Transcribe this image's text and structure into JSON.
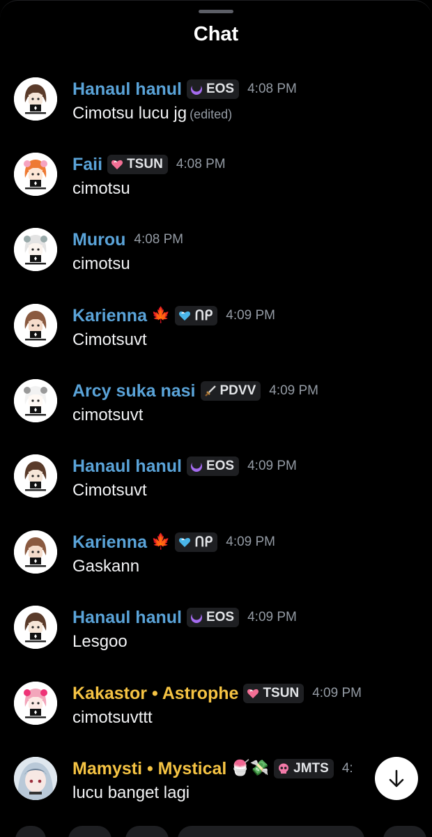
{
  "header": {
    "title": "Chat"
  },
  "messages": [
    {
      "avatar": "hanaul-avatar",
      "name": "Hanaul hanul",
      "name_color": "#5aa3d8",
      "emoji": "",
      "tag": {
        "icon": "moon-icon",
        "label": "EOS"
      },
      "time": "4:08 PM",
      "text": "Cimotsu lucu jg",
      "edited": "(edited)"
    },
    {
      "avatar": "faii-avatar",
      "name": "Faii",
      "name_color": "#5aa3d8",
      "emoji": "",
      "tag": {
        "icon": "pink-heart-icon",
        "label": "TSUN"
      },
      "time": "4:08 PM",
      "text": "cimotsu",
      "edited": ""
    },
    {
      "avatar": "murou-avatar",
      "name": "Murou",
      "name_color": "#5aa3d8",
      "emoji": "",
      "tag": null,
      "time": "4:08 PM",
      "text": "cimotsu",
      "edited": ""
    },
    {
      "avatar": "karienna-avatar",
      "name": "Karienna",
      "name_color": "#5aa3d8",
      "emoji": "🍁",
      "tag": {
        "icon": "blue-heart-icon",
        "label": "ᑎᑭ"
      },
      "time": "4:09 PM",
      "text": "Cimotsuvt",
      "edited": ""
    },
    {
      "avatar": "arcy-avatar",
      "name": "Arcy suka nasi",
      "name_color": "#5aa3d8",
      "emoji": "",
      "tag": {
        "icon": "sword-icon",
        "label": "PDVV"
      },
      "time": "4:09 PM",
      "text": "cimotsuvt",
      "edited": ""
    },
    {
      "avatar": "hanaul-avatar",
      "name": "Hanaul hanul",
      "name_color": "#5aa3d8",
      "emoji": "",
      "tag": {
        "icon": "moon-icon",
        "label": "EOS"
      },
      "time": "4:09 PM",
      "text": "Cimotsuvt",
      "edited": ""
    },
    {
      "avatar": "karienna-avatar",
      "name": "Karienna",
      "name_color": "#5aa3d8",
      "emoji": "🍁",
      "tag": {
        "icon": "blue-heart-icon",
        "label": "ᑎᑭ"
      },
      "time": "4:09 PM",
      "text": "Gaskann",
      "edited": ""
    },
    {
      "avatar": "hanaul-avatar",
      "name": "Hanaul hanul",
      "name_color": "#5aa3d8",
      "emoji": "",
      "tag": {
        "icon": "moon-icon",
        "label": "EOS"
      },
      "time": "4:09 PM",
      "text": "Lesgoo",
      "edited": ""
    },
    {
      "avatar": "kakastor-avatar",
      "name": "Kakastor • Astrophe",
      "name_color": "#f5c343",
      "emoji": "",
      "tag": {
        "icon": "pink-heart-icon",
        "label": "TSUN"
      },
      "time": "4:09 PM",
      "text": "cimotsuvttt",
      "edited": ""
    },
    {
      "avatar": "mamysti-avatar",
      "name": "Mamysti • Mystical",
      "name_color": "#f5c343",
      "emoji": "🍧💸",
      "tag": {
        "icon": "skull-icon",
        "label": "JMTS"
      },
      "time": "4:",
      "text": "lucu banget lagi",
      "edited": ""
    }
  ],
  "scroll_button": {
    "icon": "arrow-down-icon"
  }
}
